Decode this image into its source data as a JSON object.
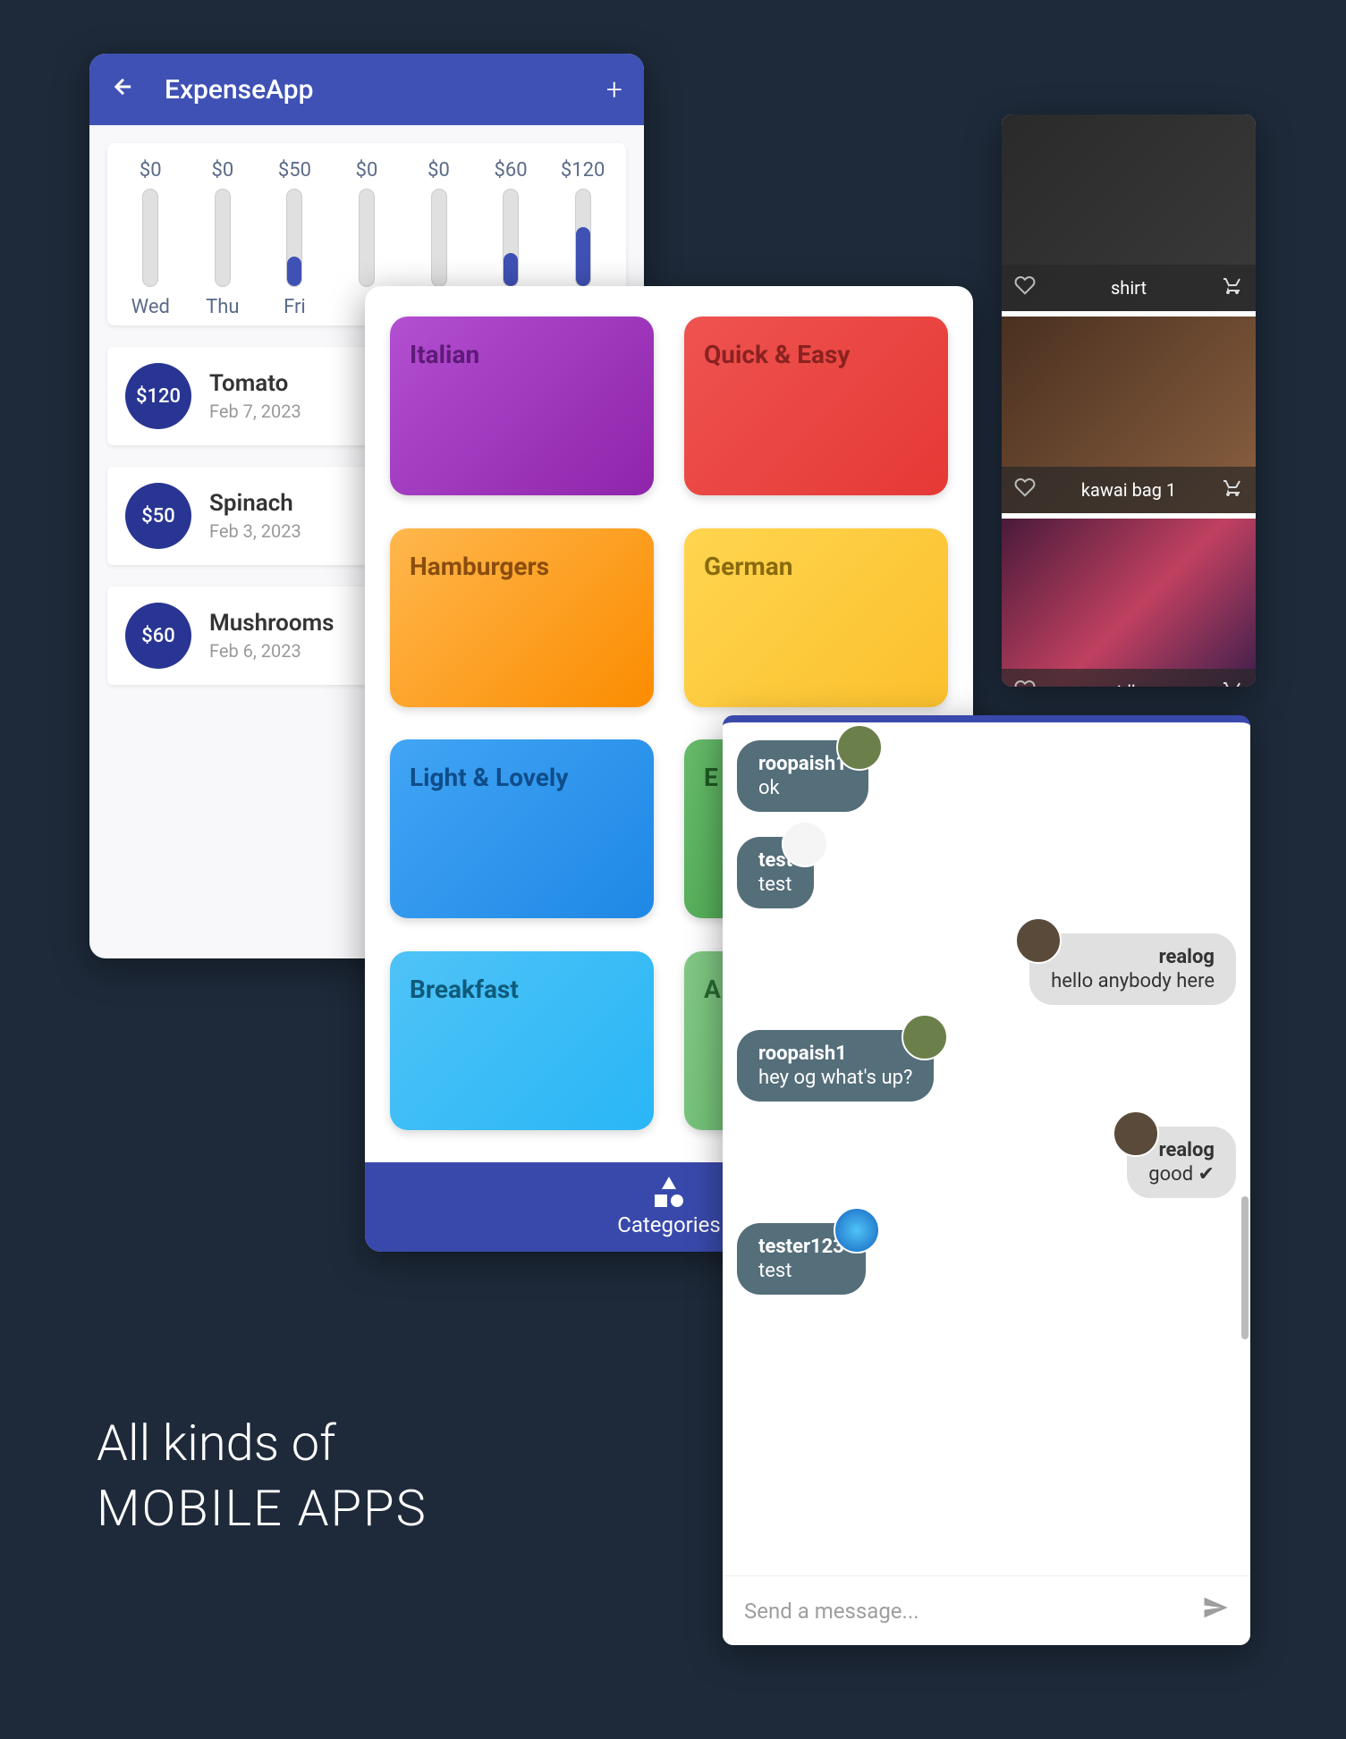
{
  "caption": {
    "line1": "All kinds of",
    "line2": "MOBILE APPS"
  },
  "expense": {
    "title": "ExpenseApp",
    "chart": [
      {
        "value": "$0",
        "day": "Wed",
        "fill": 0
      },
      {
        "value": "$0",
        "day": "Thu",
        "fill": 0
      },
      {
        "value": "$50",
        "day": "Fri",
        "fill": 22
      },
      {
        "value": "$0",
        "day": "",
        "fill": 0
      },
      {
        "value": "$0",
        "day": "",
        "fill": 0
      },
      {
        "value": "$60",
        "day": "",
        "fill": 26
      },
      {
        "value": "$120",
        "day": "",
        "fill": 52
      }
    ],
    "items": [
      {
        "amount": "$120",
        "name": "Tomato",
        "date": "Feb 7, 2023"
      },
      {
        "amount": "$50",
        "name": "Spinach",
        "date": "Feb 3, 2023"
      },
      {
        "amount": "$60",
        "name": "Mushrooms",
        "date": "Feb 6, 2023"
      }
    ]
  },
  "categories": {
    "footer_label": "Categories",
    "tiles": [
      {
        "label": "Italian",
        "bg": "linear-gradient(135deg,#b34fd1,#8e24aa)",
        "fg": "#5e1a78"
      },
      {
        "label": "Quick & Easy",
        "bg": "linear-gradient(135deg,#ef5350,#e53935)",
        "fg": "#8a2220"
      },
      {
        "label": "Hamburgers",
        "bg": "linear-gradient(135deg,#ffb74d,#fb8c00)",
        "fg": "#8a4d0e"
      },
      {
        "label": "German",
        "bg": "linear-gradient(135deg,#ffd54f,#fbc02d)",
        "fg": "#8a6a0e"
      },
      {
        "label": "Light & Lovely",
        "bg": "linear-gradient(135deg,#42a5f5,#1e88e5)",
        "fg": "#0f4d8a"
      },
      {
        "label": "E",
        "bg": "linear-gradient(135deg,#66bb6a,#43a047)",
        "fg": "#1e5a22"
      },
      {
        "label": "Breakfast",
        "bg": "linear-gradient(135deg,#4fc3f7,#29b6f6)",
        "fg": "#0f5a7a"
      },
      {
        "label": "A",
        "bg": "linear-gradient(135deg,#81c784,#66bb6a)",
        "fg": "#2a6a30"
      }
    ]
  },
  "shop": {
    "items": [
      {
        "name": "shirt"
      },
      {
        "name": "kawai bag 1"
      },
      {
        "name": "idk"
      }
    ]
  },
  "chat": {
    "placeholder": "Send a message...",
    "messages": [
      {
        "side": "left",
        "user": "roopaish1",
        "text": "ok",
        "avatar": "#6b7f4a"
      },
      {
        "side": "left",
        "user": "test",
        "text": "test",
        "avatar": "#f5f5f5"
      },
      {
        "side": "right",
        "user": "realog",
        "text": "hello anybody here",
        "avatar": "#5a4a3a"
      },
      {
        "side": "left",
        "user": "roopaish1",
        "text": "hey og what's up?",
        "avatar": "#6b7f4a"
      },
      {
        "side": "right",
        "user": "realog",
        "text": "good ✔",
        "avatar": "#5a4a3a"
      },
      {
        "side": "left",
        "user": "tester123",
        "text": "test",
        "avatar": "radial-gradient(circle,#4fc3f7,#1565c0)"
      }
    ]
  }
}
